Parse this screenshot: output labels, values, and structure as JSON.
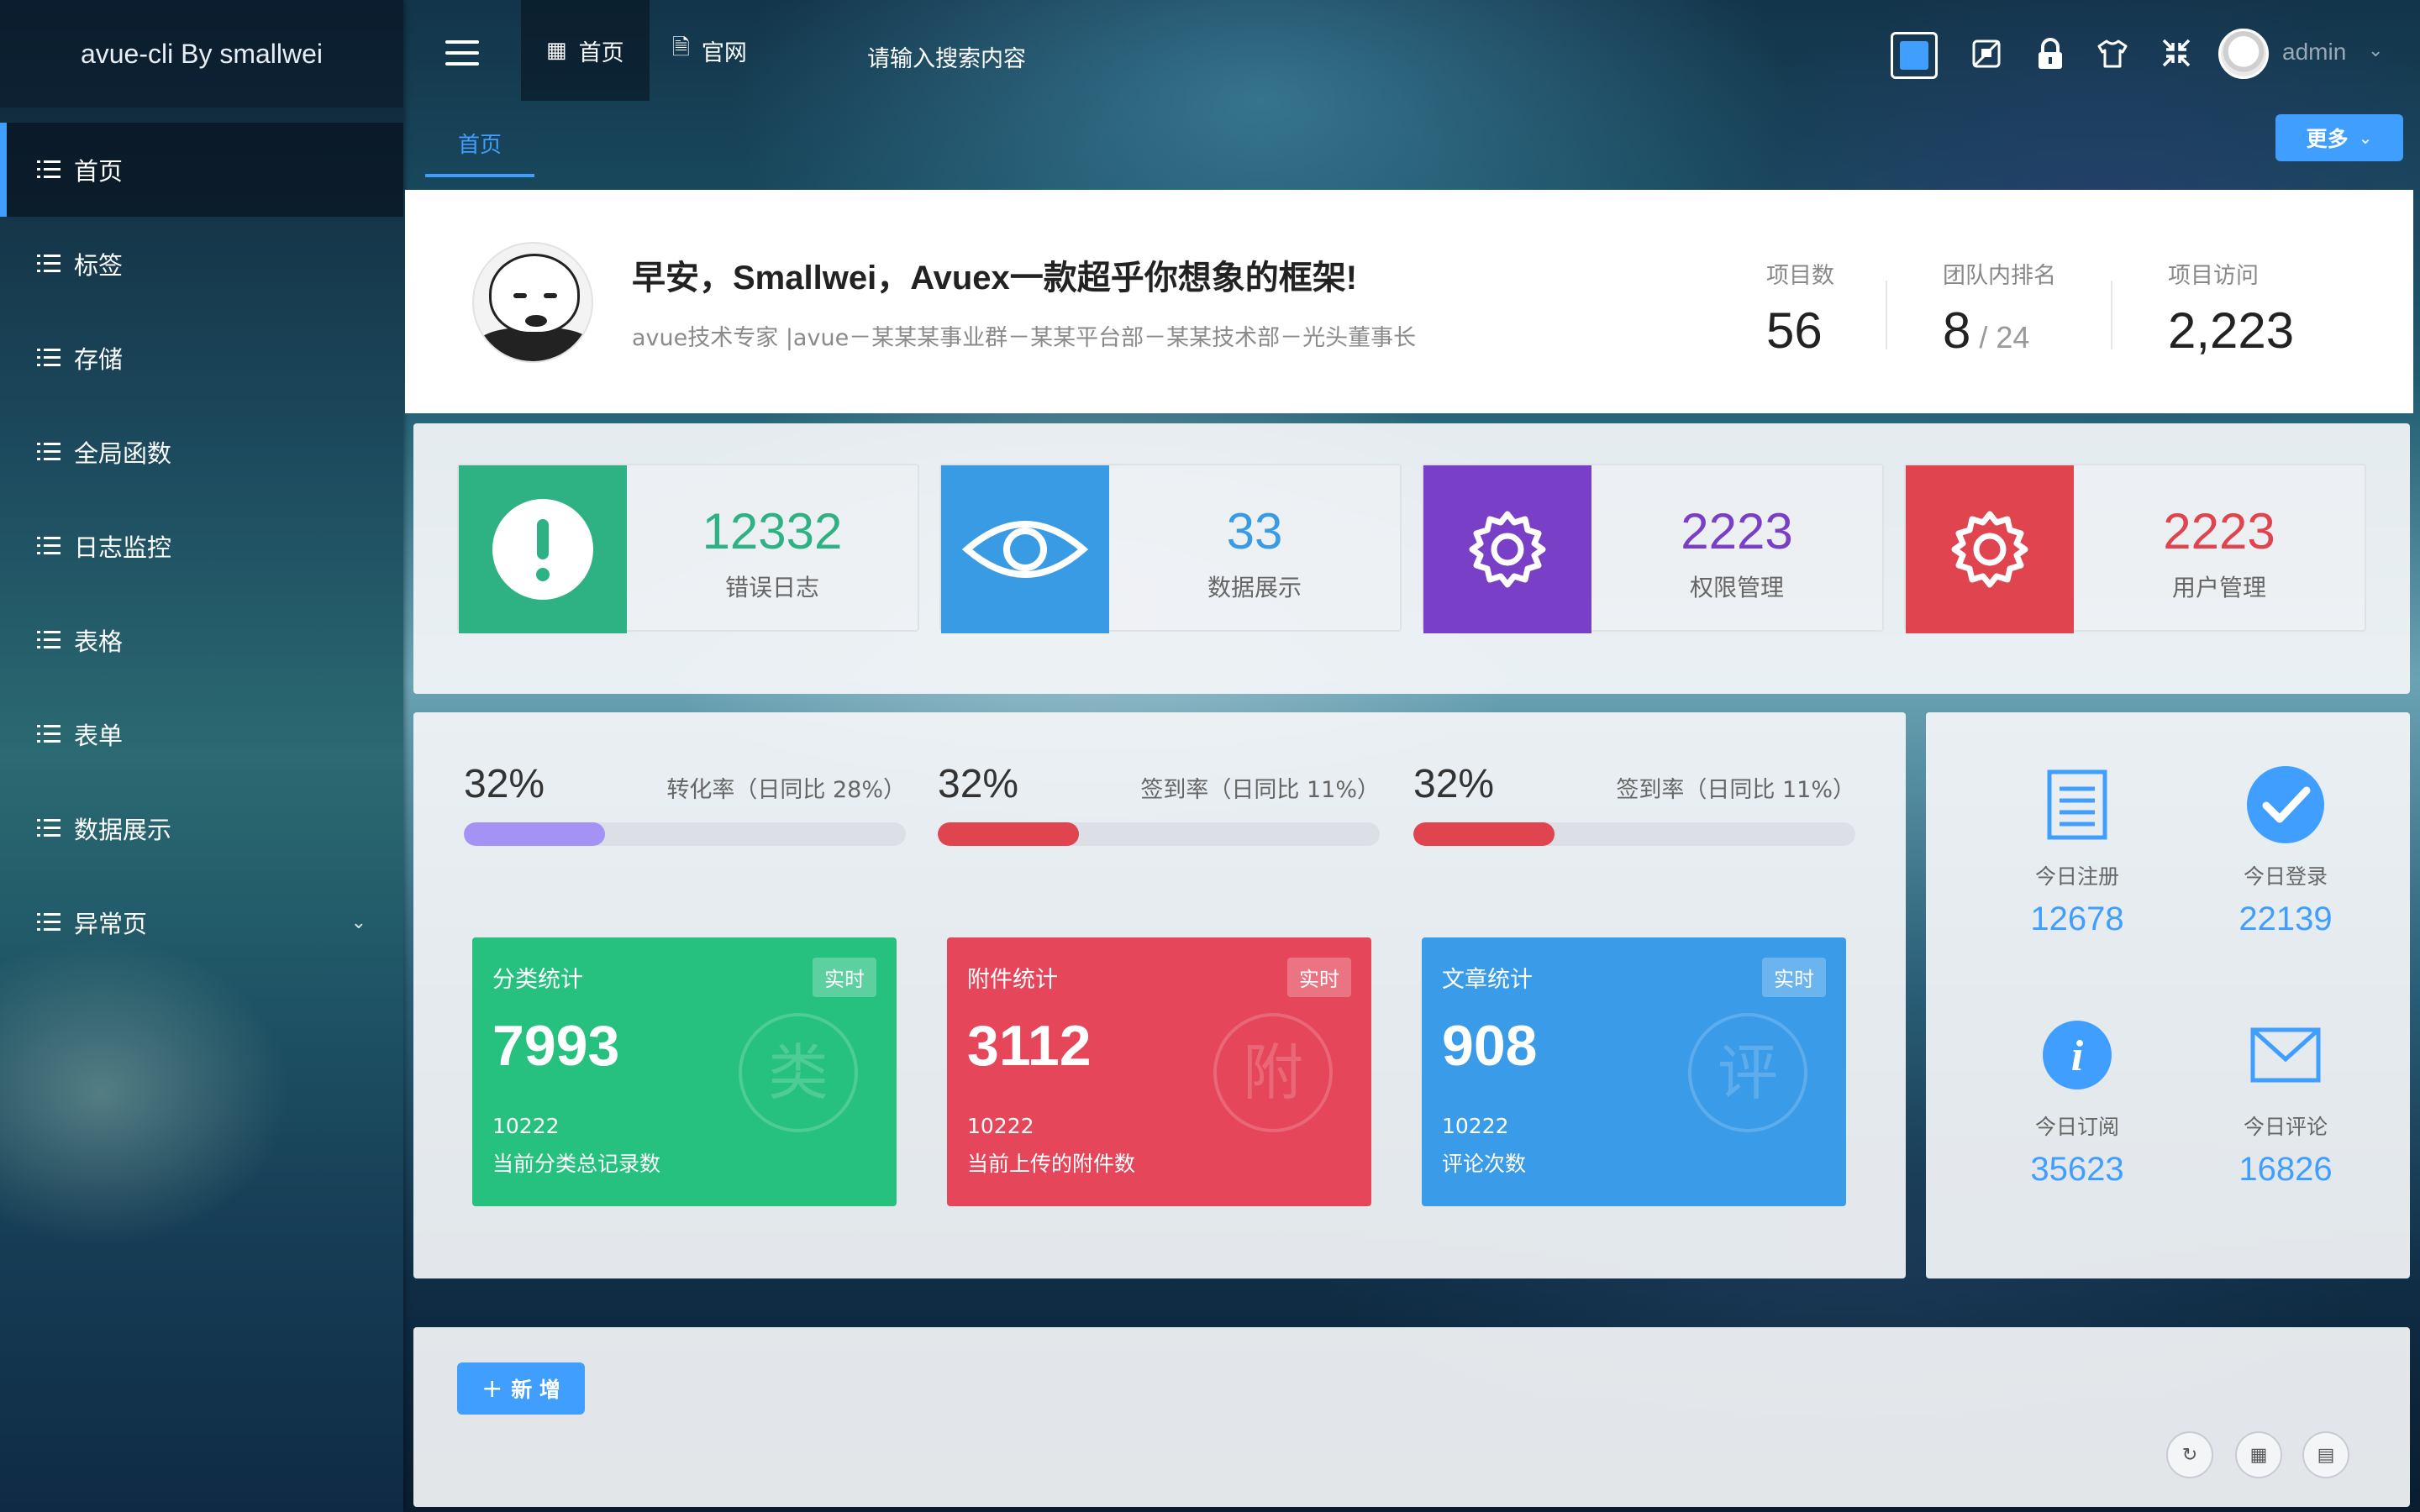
{
  "app": {
    "title": "avue-cli By smallwei"
  },
  "sidebar": {
    "items": [
      {
        "label": "首页",
        "active": true
      },
      {
        "label": "标签"
      },
      {
        "label": "存储"
      },
      {
        "label": "全局函数"
      },
      {
        "label": "日志监控"
      },
      {
        "label": "表格"
      },
      {
        "label": "表单"
      },
      {
        "label": "数据展示"
      },
      {
        "label": "异常页",
        "has_submenu": true
      }
    ]
  },
  "topbar": {
    "nav": [
      {
        "label": "首页",
        "icon": "grid-icon",
        "active": true
      },
      {
        "label": "官网",
        "icon": "document-icon"
      }
    ],
    "search_text": "请输入搜索内容",
    "tools": [
      "layout-toggle-icon",
      "screenshot-lock-icon",
      "lock-icon",
      "theme-shirt-icon",
      "fullscreen-exit-icon"
    ],
    "user": {
      "name": "admin"
    }
  },
  "tabs": {
    "items": [
      {
        "label": "首页",
        "active": true
      }
    ],
    "more_label": "更多"
  },
  "welcome": {
    "title": "早安，Smallwei，Avuex一款超乎你想象的框架!",
    "subtitle": "avue技术专家 |avue－某某某事业群－某某平台部－某某技术部－光头董事长",
    "stats": [
      {
        "label": "项目数",
        "value": "56"
      },
      {
        "label": "团队内排名",
        "value": "8",
        "suffix": " / 24"
      },
      {
        "label": "项目访问",
        "value": "2,223"
      }
    ]
  },
  "boxes": [
    {
      "value": "12332",
      "label": "错误日志",
      "icon": "exclamation-icon",
      "color": "#2eb283"
    },
    {
      "value": "33",
      "label": "数据展示",
      "icon": "eye-icon",
      "color": "#3a9be5"
    },
    {
      "value": "2223",
      "label": "权限管理",
      "icon": "gear-icon",
      "color": "#7a3fc7"
    },
    {
      "value": "2223",
      "label": "用户管理",
      "icon": "gear-icon",
      "color": "#e0444f"
    }
  ],
  "progress": [
    {
      "pct_text": "32%",
      "value": 0.32,
      "label": "转化率（日同比 28%）",
      "color": "#a493f5"
    },
    {
      "pct_text": "32%",
      "value": 0.32,
      "label": "签到率（日同比 11%）",
      "color": "#e0444f"
    },
    {
      "pct_text": "32%",
      "value": 0.32,
      "label": "签到率（日同比 11%）",
      "color": "#e0444f"
    }
  ],
  "stat_cards": [
    {
      "title": "分类统计",
      "badge": "实时",
      "value": "7993",
      "count": "10222",
      "desc": "当前分类总记录数",
      "watermark": "类",
      "color": "#26c17f"
    },
    {
      "title": "附件统计",
      "badge": "实时",
      "value": "3112",
      "count": "10222",
      "desc": "当前上传的附件数",
      "watermark": "附",
      "color": "#e5465a"
    },
    {
      "title": "文章统计",
      "badge": "实时",
      "value": "908",
      "count": "10222",
      "desc": "评论次数",
      "watermark": "评",
      "color": "#3a9be8"
    }
  ],
  "today": [
    {
      "label": "今日注册",
      "value": "12678",
      "icon": "document-lines-icon"
    },
    {
      "label": "今日登录",
      "value": "22139",
      "icon": "check-circle-icon"
    },
    {
      "label": "今日订阅",
      "value": "35623",
      "icon": "info-circle-icon"
    },
    {
      "label": "今日评论",
      "value": "16826",
      "icon": "envelope-icon"
    }
  ],
  "crud": {
    "add_label": "新 增",
    "tools": [
      "refresh-icon",
      "columns-icon",
      "filter-icon"
    ]
  },
  "colors": {
    "accent": "#409eff"
  }
}
